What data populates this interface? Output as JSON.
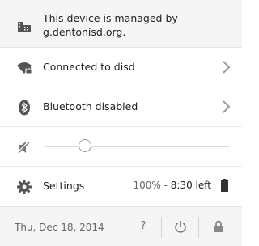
{
  "managed": {
    "line1": "This device is managed by",
    "line2": "g.dentonisd.org."
  },
  "network": {
    "label": "Connected to disd"
  },
  "bluetooth": {
    "label": "Bluetooth disabled"
  },
  "volume": {
    "level": 0.22,
    "muted": true
  },
  "settings": {
    "label": "Settings"
  },
  "battery": {
    "percent": "100%",
    "separator": " - ",
    "time": "8:30 left"
  },
  "footer": {
    "date": "Thu, Dec 18, 2014",
    "help_label": "?"
  },
  "icons": {
    "managed": "building-icon",
    "network": "wifi-locked-icon",
    "bluetooth": "bluetooth-icon",
    "volume": "volume-muted-icon",
    "settings": "gear-icon",
    "battery": "battery-icon",
    "chevron": "chevron-right-icon",
    "power": "power-icon",
    "lock": "lock-icon"
  }
}
